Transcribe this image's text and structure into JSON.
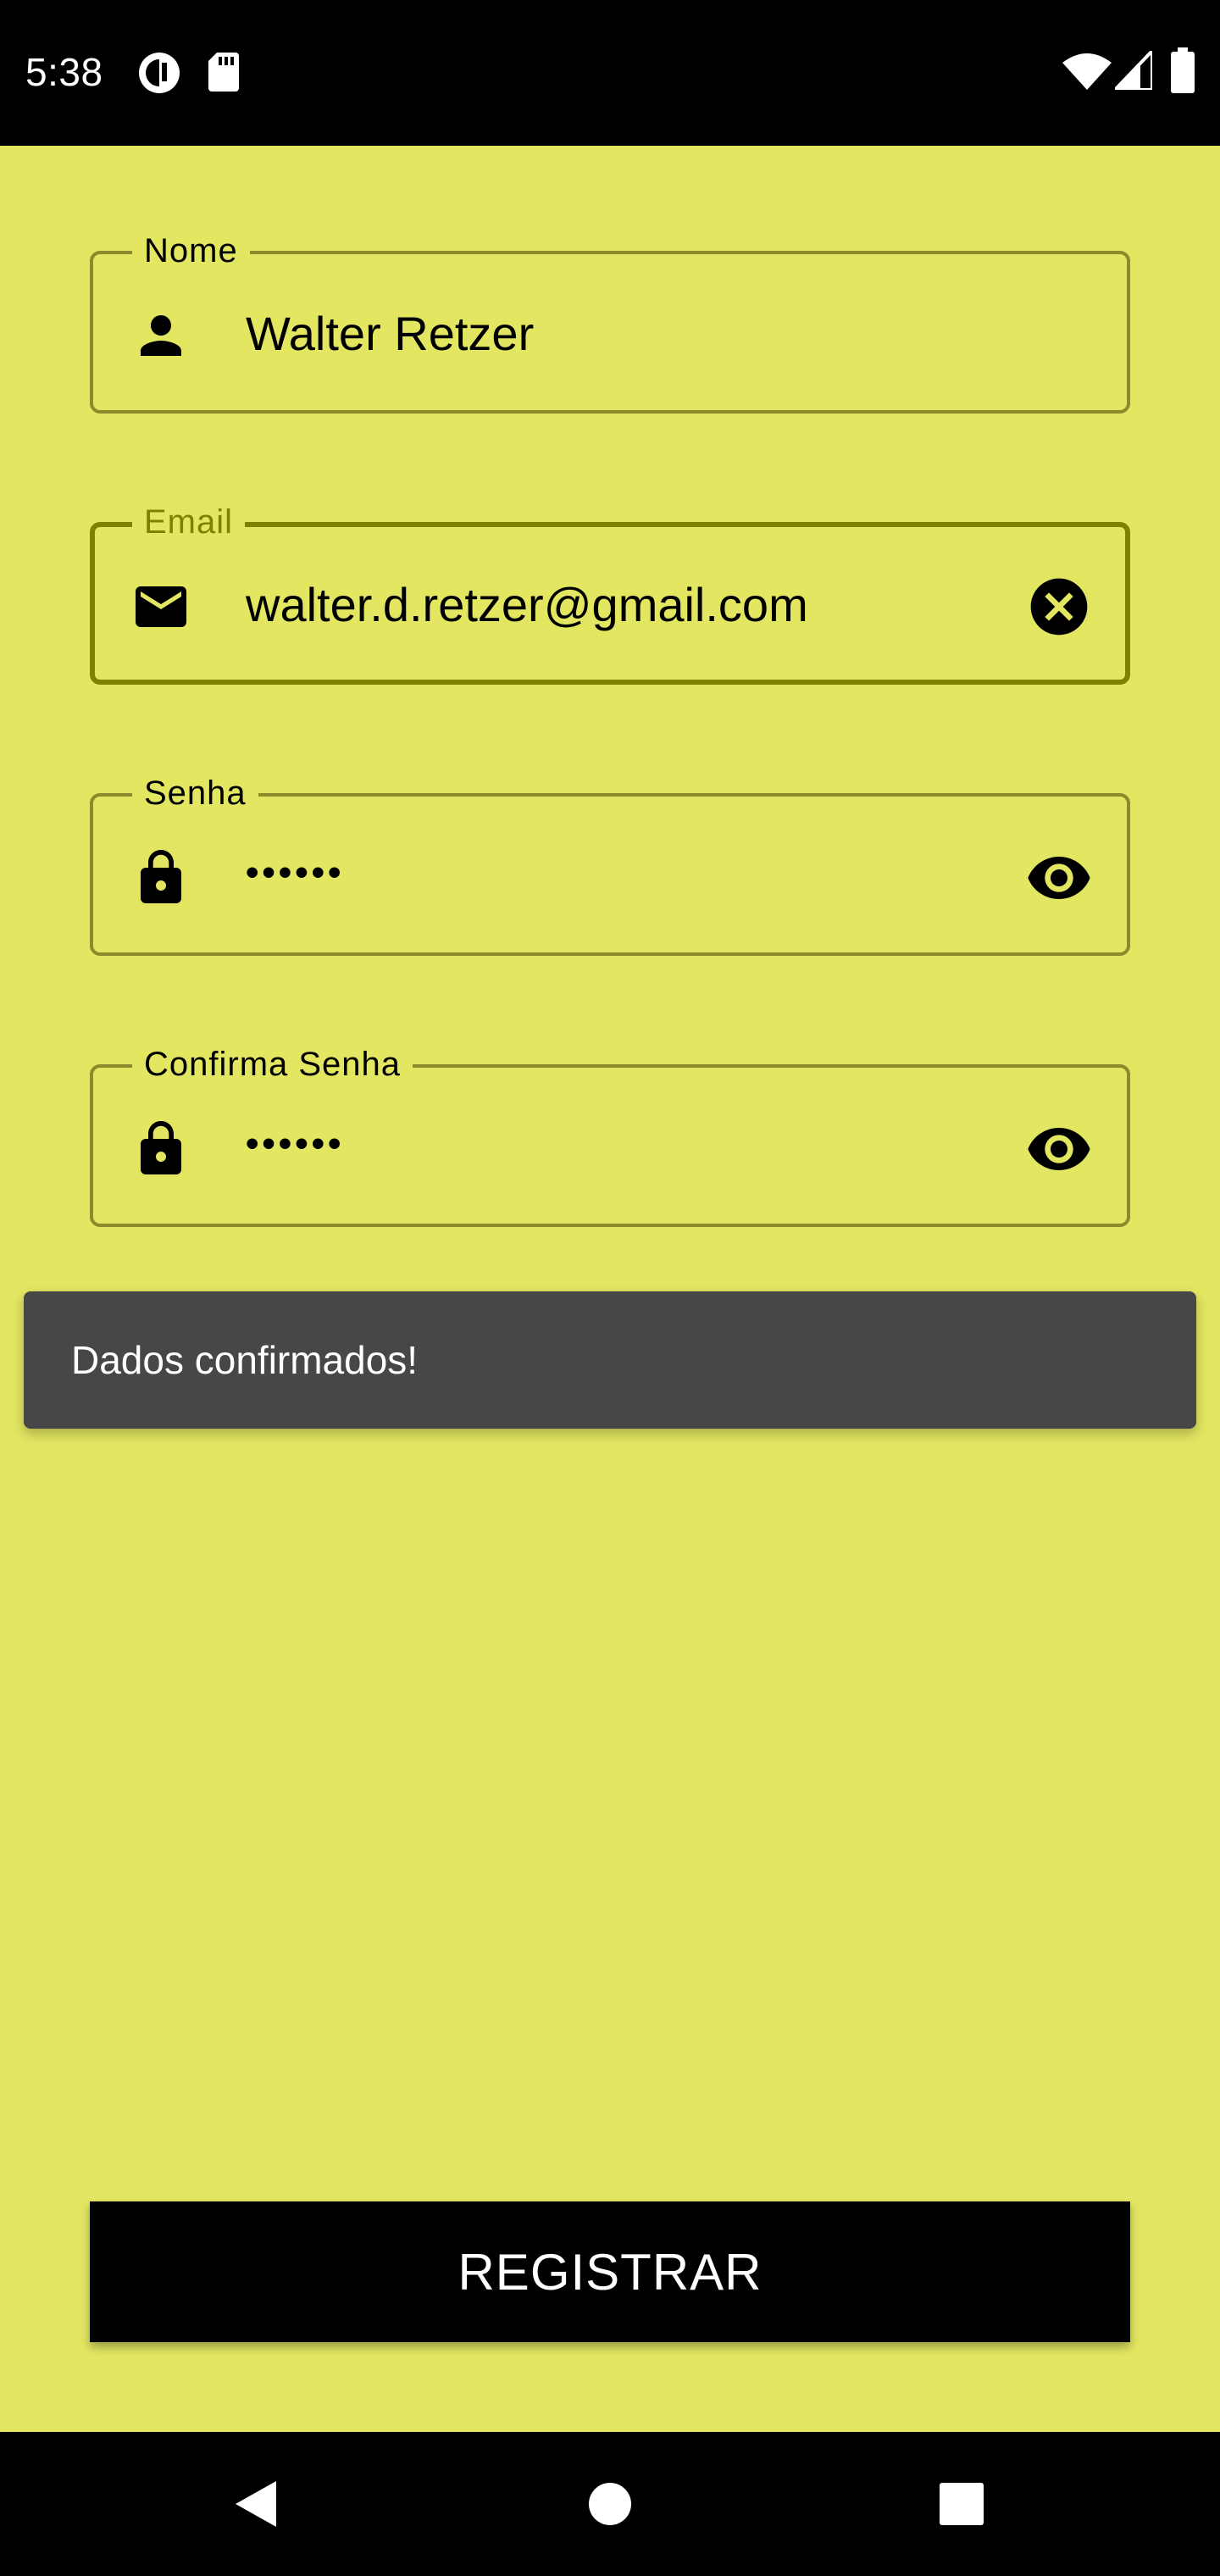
{
  "status_bar": {
    "time": "5:38",
    "left_icons": [
      "sync-icon",
      "sd-card-icon"
    ],
    "right_icons": [
      "wifi-icon",
      "signal-icon",
      "battery-icon"
    ]
  },
  "form": {
    "name": {
      "label": "Nome",
      "value": "Walter Retzer",
      "icon": "person-icon"
    },
    "email": {
      "label": "Email",
      "value": "walter.d.retzer@gmail.com",
      "icon": "mail-icon",
      "trailing_icon": "clear-icon"
    },
    "password": {
      "label": "Senha",
      "value": "••••••",
      "icon": "lock-icon",
      "trailing_icon": "eye-icon"
    },
    "confirm_password": {
      "label": "Confirma Senha",
      "value": "••••••",
      "icon": "lock-icon",
      "trailing_icon": "eye-icon"
    }
  },
  "snackbar": {
    "message": "Dados confirmados!"
  },
  "register_button": {
    "label": "REGISTRAR"
  },
  "nav_bar": {
    "icons": [
      "back-icon",
      "home-icon",
      "recents-icon"
    ]
  },
  "colors": {
    "background": "#e2e661",
    "field_border": "#8a8b2a",
    "focused_accent": "#7e8000",
    "snackbar": "#474747",
    "button": "#000000"
  }
}
